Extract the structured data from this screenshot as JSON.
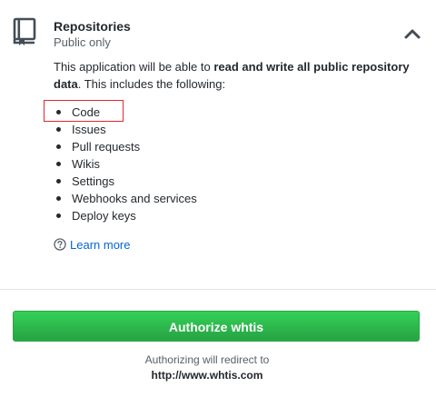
{
  "permission": {
    "icon": "repo-icon",
    "title": "Repositories",
    "scope": "Public only",
    "collapse_icon": "chevron-up-icon",
    "description_prefix": "This application will be able to ",
    "description_bold": "read and write all public repository data",
    "description_suffix": ". This includes the following:",
    "items": [
      {
        "label": "Code",
        "highlighted": true
      },
      {
        "label": "Issues"
      },
      {
        "label": "Pull requests"
      },
      {
        "label": "Wikis"
      },
      {
        "label": "Settings"
      },
      {
        "label": "Webhooks and services"
      },
      {
        "label": "Deploy keys"
      }
    ],
    "learn_more": {
      "icon": "question-circle-icon",
      "label": "Learn more"
    }
  },
  "authorize": {
    "button_label": "Authorize whtis",
    "redirect_note": "Authorizing will redirect to",
    "redirect_url": "http://www.whtis.com"
  },
  "colors": {
    "accent_green": "#2ea44f",
    "link_blue": "#0366d6",
    "highlight_red": "#e0282d"
  }
}
